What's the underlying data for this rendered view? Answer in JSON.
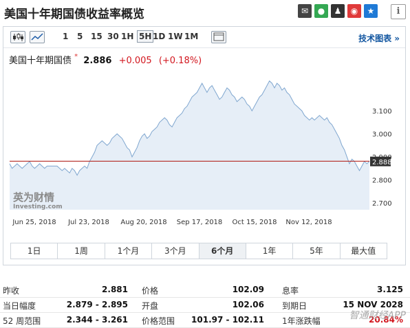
{
  "header": {
    "title": "美国十年期国债收益率概览",
    "share_icons": [
      "envelope-icon",
      "wechat-icon",
      "qq-icon",
      "weibo-icon",
      "star-icon"
    ],
    "info_label": "i"
  },
  "toolbar": {
    "timeframes": [
      "1",
      "5",
      "15",
      "30",
      "1H",
      "5H",
      "1D",
      "1W",
      "1M"
    ],
    "active_timeframe": "5H",
    "tech_label": "技术图表 »"
  },
  "quote": {
    "name": "美国十年期国债",
    "star": "*",
    "price": "2.886",
    "change": "+0.005",
    "change_pct": "(+0.18%)"
  },
  "colors": {
    "line": "#7fa6cf",
    "area": "#e6eef7",
    "ref_line": "#b52a24",
    "up": "#d2161e",
    "price_tag": "#333333"
  },
  "chart_data": {
    "type": "area",
    "y_ticks": [
      "3.100",
      "3.000",
      "2.900",
      "2.800",
      "2.700"
    ],
    "x_tick_labels": [
      "Jun 25, 2018",
      "Jul 23, 2018",
      "Aug 20, 2018",
      "Sep 17, 2018",
      "Oct 15, 2018",
      "Nov 12, 2018"
    ],
    "ylim": [
      2.67,
      3.28
    ],
    "last_price_label": "2.888",
    "reference_value": 2.881,
    "values": [
      2.87,
      2.85,
      2.86,
      2.87,
      2.86,
      2.85,
      2.86,
      2.87,
      2.88,
      2.86,
      2.85,
      2.86,
      2.87,
      2.86,
      2.85,
      2.86,
      2.86,
      2.86,
      2.86,
      2.86,
      2.85,
      2.84,
      2.85,
      2.84,
      2.83,
      2.85,
      2.84,
      2.82,
      2.84,
      2.85,
      2.86,
      2.85,
      2.88,
      2.9,
      2.92,
      2.95,
      2.96,
      2.97,
      2.96,
      2.95,
      2.96,
      2.98,
      2.99,
      3.0,
      2.99,
      2.98,
      2.96,
      2.94,
      2.93,
      2.9,
      2.92,
      2.94,
      2.97,
      2.99,
      3.0,
      2.98,
      2.99,
      3.01,
      3.02,
      3.03,
      3.05,
      3.06,
      3.07,
      3.06,
      3.04,
      3.03,
      3.05,
      3.07,
      3.08,
      3.09,
      3.11,
      3.12,
      3.14,
      3.16,
      3.17,
      3.18,
      3.2,
      3.22,
      3.2,
      3.18,
      3.2,
      3.21,
      3.19,
      3.17,
      3.15,
      3.16,
      3.18,
      3.2,
      3.19,
      3.17,
      3.16,
      3.14,
      3.15,
      3.16,
      3.15,
      3.13,
      3.12,
      3.1,
      3.12,
      3.14,
      3.16,
      3.17,
      3.19,
      3.21,
      3.23,
      3.22,
      3.2,
      3.22,
      3.21,
      3.19,
      3.2,
      3.18,
      3.17,
      3.15,
      3.13,
      3.12,
      3.11,
      3.1,
      3.08,
      3.07,
      3.06,
      3.07,
      3.06,
      3.07,
      3.08,
      3.07,
      3.06,
      3.07,
      3.05,
      3.04,
      3.02,
      3.0,
      2.98,
      2.95,
      2.93,
      2.9,
      2.87,
      2.89,
      2.88,
      2.86,
      2.84,
      2.86,
      2.88,
      2.87,
      2.88
    ]
  },
  "watermark_logo": "英为财情 Investing.com",
  "ranges": [
    "1日",
    "1周",
    "1个月",
    "3个月",
    "6个月",
    "1年",
    "5年",
    "最大值"
  ],
  "active_range": "6个月",
  "stats": [
    {
      "label": "昨收",
      "value": "2.881"
    },
    {
      "label": "价格",
      "value": "102.09"
    },
    {
      "label": "息率",
      "value": "3.125"
    },
    {
      "label": "当日幅度",
      "value": "2.879 - 2.895"
    },
    {
      "label": "开盘",
      "value": "102.06"
    },
    {
      "label": "到期日",
      "value": "15 NOV 2028"
    },
    {
      "label": "52 周范围",
      "value": "2.344 - 3.261"
    },
    {
      "label": "价格范围",
      "value": "101.97 - 102.11"
    },
    {
      "label": "1年涨跌幅",
      "value": "20.84%"
    }
  ],
  "app_watermark": "智通财经APP"
}
